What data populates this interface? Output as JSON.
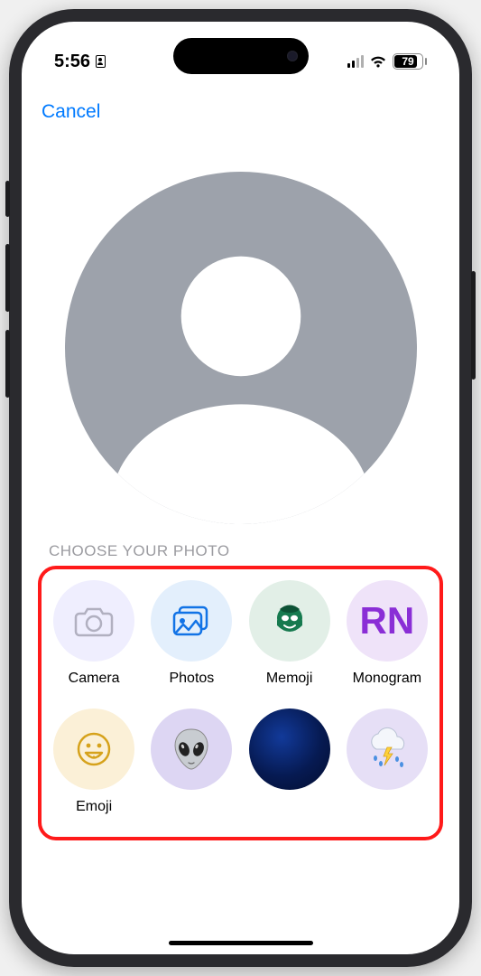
{
  "status": {
    "time": "5:56",
    "battery_pct": "79"
  },
  "nav": {
    "cancel_label": "Cancel"
  },
  "section": {
    "heading": "CHOOSE YOUR PHOTO"
  },
  "options": {
    "camera_label": "Camera",
    "photos_label": "Photos",
    "memoji_label": "Memoji",
    "monogram_label": "Monogram",
    "monogram_initials": "RN",
    "emoji_label": "Emoji"
  }
}
